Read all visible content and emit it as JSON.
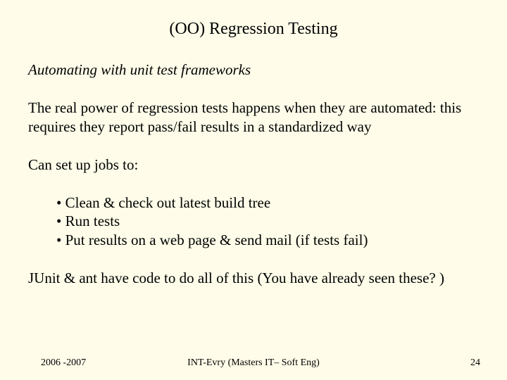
{
  "title": "(OO) Regression Testing",
  "subtitle": "Automating with unit test frameworks",
  "para1": "The real power of regression tests happens when they are automated: this requires they report pass/fail results in a standardized way",
  "para2": "Can set up jobs to:",
  "bullets": {
    "b1": "Clean & check out latest build tree",
    "b2": "Run tests",
    "b3": "Put results on a web page & send mail (if tests fail)"
  },
  "para3": "JUnit & ant have code to do all of this (You have already seen these? )",
  "footer": {
    "left": "2006 -2007",
    "center": "INT-Evry (Masters IT– Soft Eng)",
    "right": "24"
  }
}
